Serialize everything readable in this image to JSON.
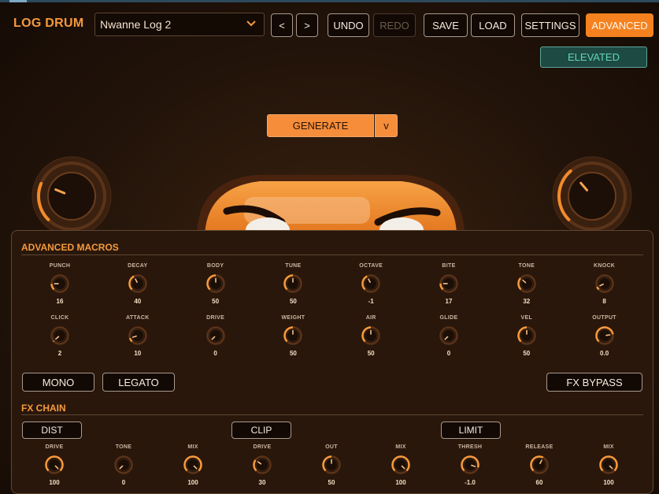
{
  "app": {
    "title": "LOG DRUM"
  },
  "preset": {
    "name": "Nwanne Log 2"
  },
  "toolbar": {
    "prev": "<",
    "next": ">",
    "undo": "UNDO",
    "redo": "REDO",
    "save": "SAVE",
    "load": "LOAD",
    "settings": "SETTINGS",
    "advanced": "ADVANCED",
    "elevated": "ELEVATED"
  },
  "generate": {
    "label": "GENERATE",
    "menu": "v"
  },
  "icons": {
    "preset_dropdown": "chevron-down-icon"
  },
  "colors": {
    "accent": "#f5821f",
    "elevated_text": "#62d5b9",
    "label": "#f59a3d"
  },
  "advanced": {
    "heading": "ADVANCED MACROS",
    "macros": [
      {
        "label": "PUNCH",
        "value": "16",
        "level": 0.16
      },
      {
        "label": "DECAY",
        "value": "40",
        "level": 0.4
      },
      {
        "label": "BODY",
        "value": "50",
        "level": 0.5
      },
      {
        "label": "TUNE",
        "value": "50",
        "level": 0.5
      },
      {
        "label": "OCTAVE",
        "value": "-1",
        "level": 0.4
      },
      {
        "label": "BITE",
        "value": "17",
        "level": 0.17
      },
      {
        "label": "TONE",
        "value": "32",
        "level": 0.32
      },
      {
        "label": "KNOCK",
        "value": "8",
        "level": 0.08
      },
      {
        "label": "CLICK",
        "value": "2",
        "level": 0.02
      },
      {
        "label": "ATTACK",
        "value": "10",
        "level": 0.1
      },
      {
        "label": "DRIVE",
        "value": "0",
        "level": 0.0
      },
      {
        "label": "WEIGHT",
        "value": "50",
        "level": 0.5
      },
      {
        "label": "AIR",
        "value": "50",
        "level": 0.5
      },
      {
        "label": "GLIDE",
        "value": "0",
        "level": 0.0
      },
      {
        "label": "VEL",
        "value": "50",
        "level": 0.5
      },
      {
        "label": "OUTPUT",
        "value": "0.0",
        "level": 0.8
      }
    ],
    "mono": "MONO",
    "legato": "LEGATO",
    "fx_bypass": "FX BYPASS"
  },
  "fx": {
    "heading": "FX CHAIN",
    "dist": "DIST",
    "clip": "CLIP",
    "limit": "LIMIT",
    "knobs": [
      {
        "label": "DRIVE",
        "value": "100",
        "level": 1.0
      },
      {
        "label": "TONE",
        "value": "0",
        "level": 0.0
      },
      {
        "label": "MIX",
        "value": "100",
        "level": 1.0
      },
      {
        "label": "DRIVE",
        "value": "30",
        "level": 0.3
      },
      {
        "label": "OUT",
        "value": "50",
        "level": 0.5
      },
      {
        "label": "MIX",
        "value": "100",
        "level": 1.0
      },
      {
        "label": "THRESH",
        "value": "-1.0",
        "level": 0.9
      },
      {
        "label": "RELEASE",
        "value": "60",
        "level": 0.6
      },
      {
        "label": "MIX",
        "value": "100",
        "level": 1.0
      }
    ]
  },
  "big_knobs": {
    "left_level": 0.25,
    "right_level": 0.35
  }
}
